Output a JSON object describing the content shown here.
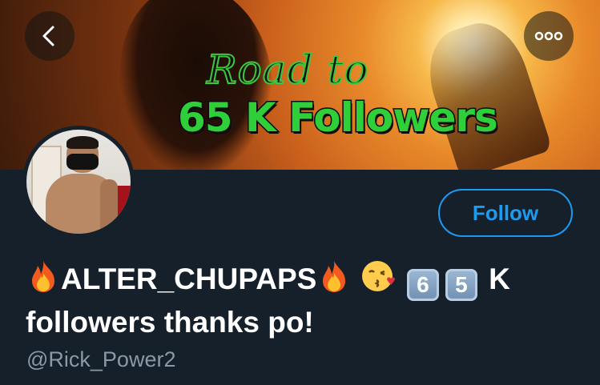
{
  "banner": {
    "line1": "Road to",
    "line2": "65 K Followers"
  },
  "profile": {
    "display_name_text": "ALTER_CHUPAPS",
    "name_digit_1": "6",
    "name_digit_2": "5",
    "name_suffix_1": "K",
    "name_suffix_2": "followers thanks po!",
    "handle": "@Rick_Power2"
  },
  "actions": {
    "follow_label": "Follow"
  },
  "icons": {
    "back": "chevron-left-icon",
    "more": "more-horizontal-icon",
    "fire": "fire-emoji",
    "kiss": "face-blowing-kiss-emoji"
  },
  "colors": {
    "background": "#15202b",
    "accent": "#1d9bf0",
    "handle": "#8b98a5"
  }
}
